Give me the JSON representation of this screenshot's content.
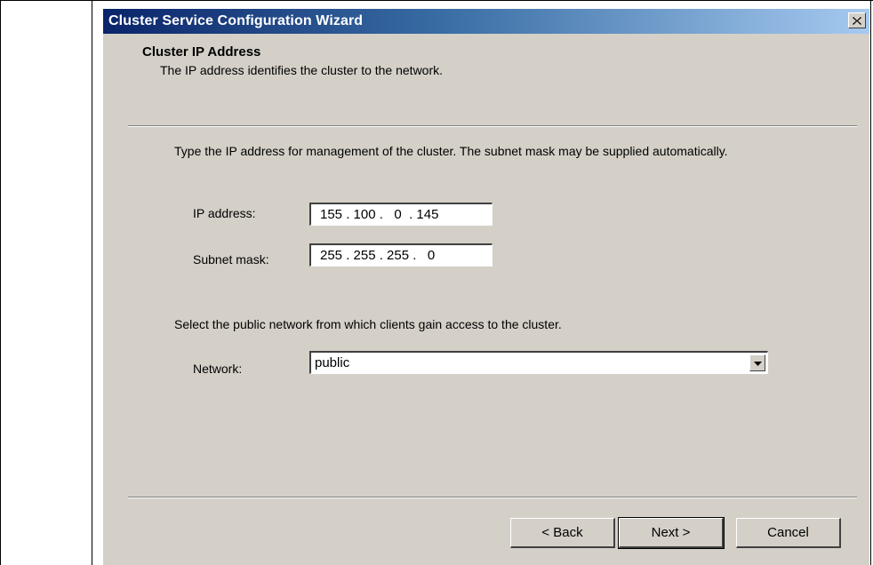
{
  "window": {
    "title": "Cluster Service Configuration Wizard",
    "close_label": "x"
  },
  "header": {
    "title": "Cluster IP Address",
    "subtitle": "The IP address identifies the cluster to the network."
  },
  "body": {
    "instruction": "Type the IP address for management of the cluster. The subnet mask may be supplied automatically.",
    "ip_label": "IP address:",
    "ip_value": "155 . 100 .   0  . 145",
    "subnet_label": "Subnet mask:",
    "subnet_value": "255 . 255 . 255 .   0",
    "network_instruction": "Select the public network from which clients gain access to the cluster.",
    "network_label": "Network:",
    "network_value": "public"
  },
  "buttons": {
    "back": "< Back",
    "next": "Next >",
    "cancel": "Cancel"
  }
}
